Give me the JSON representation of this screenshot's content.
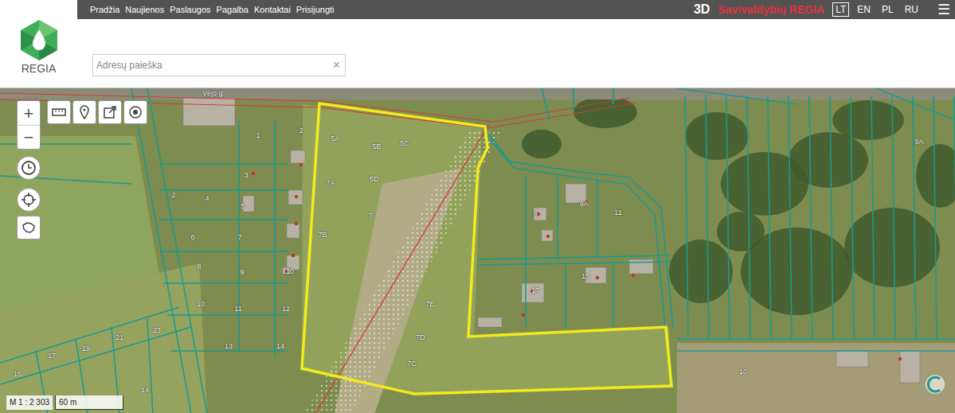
{
  "nav": {
    "links": [
      "Pradžia",
      "Naujienos",
      "Paslaugos",
      "Pagalba",
      "Kontaktai",
      "Prisijungti"
    ],
    "mode": "3D",
    "brand": "Savivaldybių REGIA",
    "languages": [
      {
        "label": "LT",
        "selected": true
      },
      {
        "label": "EN",
        "selected": false
      },
      {
        "label": "PL",
        "selected": false
      },
      {
        "label": "RU",
        "selected": false
      }
    ],
    "menu": "☰"
  },
  "logo": {
    "text": "REGIA"
  },
  "search": {
    "placeholder": "Adresų paieška",
    "clear": "×"
  },
  "map": {
    "tools": {
      "zoom_in": "+",
      "zoom_out": "−"
    },
    "street": "Vėjo g.",
    "labels": [
      {
        "text": "5A"
      },
      {
        "text": "5B"
      },
      {
        "text": "5C"
      },
      {
        "text": "5D"
      },
      {
        "text": "7A"
      },
      {
        "text": "7"
      },
      {
        "text": "7B"
      },
      {
        "text": "7E"
      },
      {
        "text": "7D"
      },
      {
        "text": "7C"
      },
      {
        "text": "1"
      },
      {
        "text": "2"
      },
      {
        "text": "3"
      },
      {
        "text": "4"
      },
      {
        "text": "2"
      },
      {
        "text": "5"
      },
      {
        "text": "6"
      },
      {
        "text": "7"
      },
      {
        "text": "8"
      },
      {
        "text": "9"
      },
      {
        "text": "10"
      },
      {
        "text": "10"
      },
      {
        "text": "11"
      },
      {
        "text": "12"
      },
      {
        "text": "13"
      },
      {
        "text": "14"
      },
      {
        "text": "15"
      },
      {
        "text": "17"
      },
      {
        "text": "19"
      },
      {
        "text": "21"
      },
      {
        "text": "23"
      },
      {
        "text": "14"
      },
      {
        "text": "9"
      },
      {
        "text": "9A"
      },
      {
        "text": "11"
      },
      {
        "text": "17"
      },
      {
        "text": "15"
      },
      {
        "text": "9A"
      },
      {
        "text": "10"
      }
    ],
    "scale": {
      "ratio": "M 1 : 2 303",
      "bar": "60 m"
    }
  }
}
